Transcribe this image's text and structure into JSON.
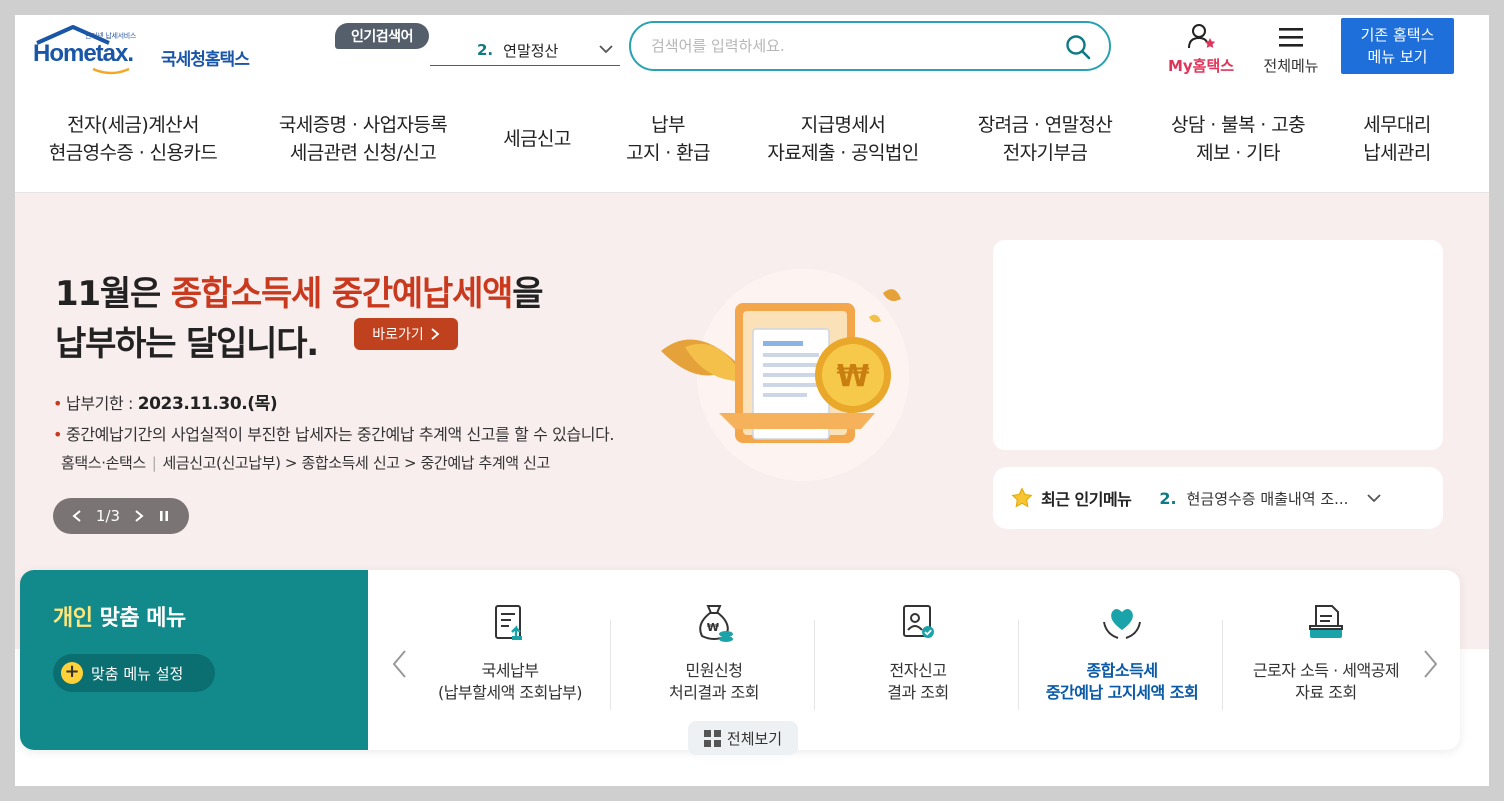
{
  "header": {
    "logo_tiny": "인터넷 납세서비스",
    "logo_word": "Hometax.",
    "logo_kor": "국세청홈택스",
    "popular_badge": "인기검색어",
    "popular_rank": "2.",
    "popular_term": "연말정산",
    "search_placeholder": "검색어를 입력하세요.",
    "my_hometax": "My홈택스",
    "all_menu": "전체메뉴",
    "old_menu_line1": "기존 홈택스",
    "old_menu_line2": "메뉴 보기"
  },
  "nav": {
    "items": [
      {
        "line1": "전자(세금)계산서",
        "line2": "현금영수증 · 신용카드"
      },
      {
        "line1": "국세증명 · 사업자등록",
        "line2": "세금관련 신청/신고"
      },
      {
        "line1": "세금신고",
        "line2": ""
      },
      {
        "line1": "납부",
        "line2": "고지 · 환급"
      },
      {
        "line1": "지급명세서",
        "line2": "자료제출 · 공익법인"
      },
      {
        "line1": "장려금 · 연말정산",
        "line2": "전자기부금"
      },
      {
        "line1": "상담 · 불복 · 고충",
        "line2": "제보 · 기타"
      },
      {
        "line1": "세무대리",
        "line2": "납세관리"
      }
    ]
  },
  "hero": {
    "title_prefix": "11월은 ",
    "title_highlight": "종합소득세 중간예납세액",
    "title_suffix": "을",
    "title_line2": "납부하는 달입니다.",
    "goto_label": "바로가기",
    "deadline_label": "납부기한 : ",
    "deadline_date": "2023.11.30.(목)",
    "notice": "중간예납기간의 사업실적이 부진한 납세자는 중간예납 추계액 신고를 할 수 있습니다.",
    "path_start": "홈택스·손택스",
    "path_rest": "세금신고(신고납부) > 종합소득세 신고 > 중간예납 추계액 신고",
    "pager_label": "1/3"
  },
  "recent_menu": {
    "title": "최근 인기메뉴",
    "rank": "2.",
    "value": "현금영수증 매출내역 조..."
  },
  "personal_menu": {
    "title_highlight": "개인",
    "title_rest": " 맞춤 메뉴",
    "settings_label": "맞춤 메뉴 설정",
    "view_all": "전체보기",
    "items": [
      {
        "line1": "국세납부",
        "line2": "(납부할세액 조회납부)",
        "icon": "tax-payment-icon"
      },
      {
        "line1": "민원신청",
        "line2": "처리결과 조회",
        "icon": "money-bag-icon"
      },
      {
        "line1": "전자신고",
        "line2": "결과 조회",
        "icon": "e-filing-icon"
      },
      {
        "line1": "종합소득세",
        "line2": "중간예납 고지세액 조회",
        "icon": "heart-hands-icon"
      },
      {
        "line1": "근로자 소득 · 세액공제",
        "line2": "자료 조회",
        "icon": "document-tray-icon"
      }
    ]
  },
  "colors": {
    "brand_blue": "#1a56a8",
    "teal": "#128a8c",
    "accent_red": "#c8391e",
    "hero_bg": "#f9eeee"
  }
}
